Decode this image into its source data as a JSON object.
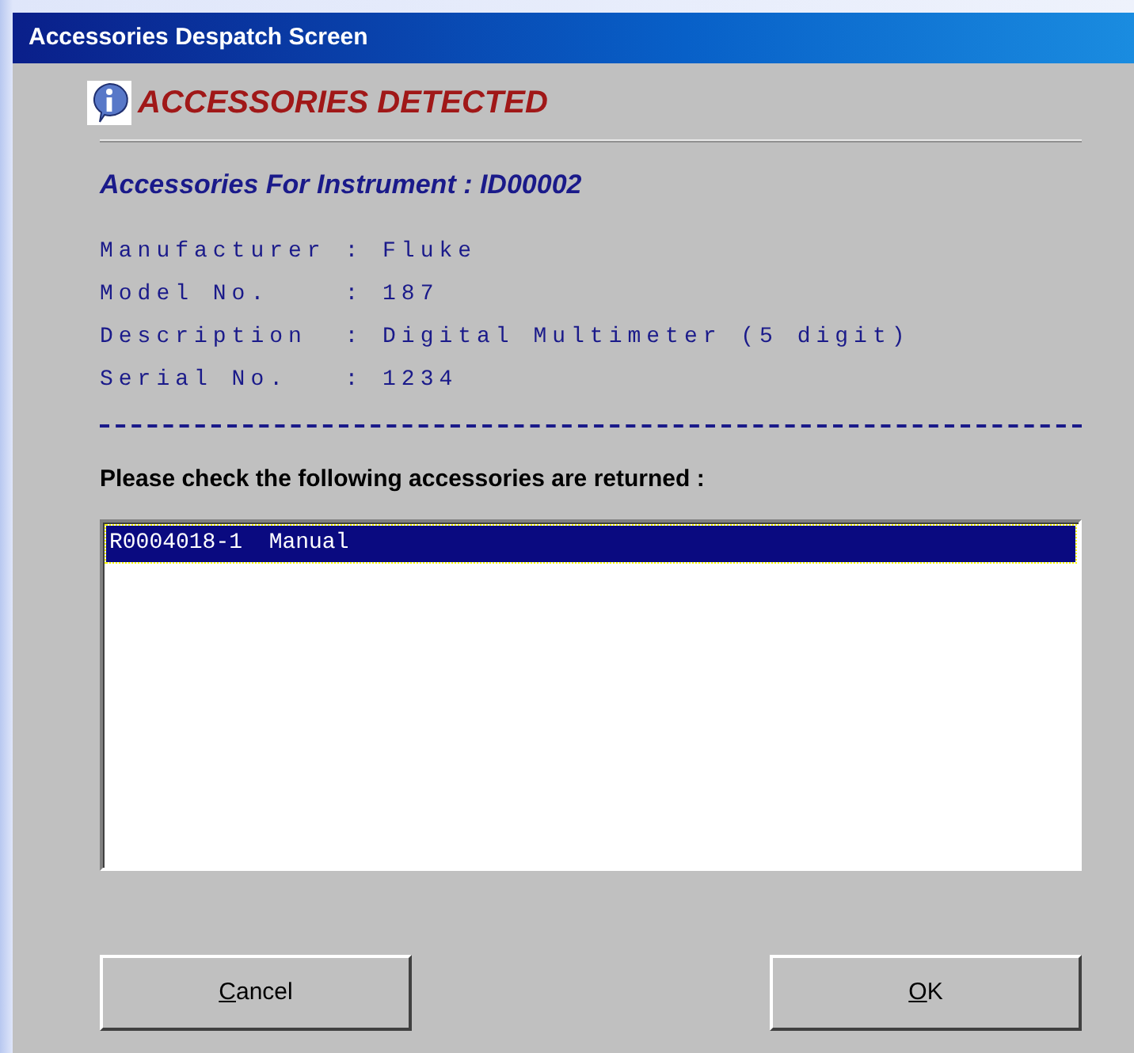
{
  "window": {
    "title": "Accessories Despatch Screen"
  },
  "heading": "ACCESSORIES DETECTED",
  "subheading": "Accessories For Instrument : ID00002",
  "details": [
    "Manufacturer : Fluke",
    "Model No.    : 187",
    "Description  : Digital Multimeter (5 digit)",
    "Serial No.   : 1234"
  ],
  "prompt": "Please check the following accessories are returned :",
  "accessories": [
    {
      "text": "R0004018-1  Manual",
      "selected": true
    }
  ],
  "buttons": [
    "Cancel",
    "OK"
  ]
}
